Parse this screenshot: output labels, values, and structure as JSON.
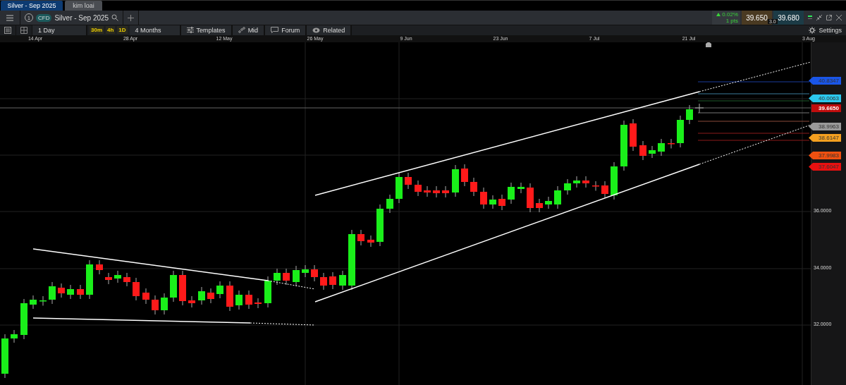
{
  "window_tabs": [
    {
      "label": "Silver - Sep 2025",
      "selected": true
    },
    {
      "label": "kim loai",
      "selected": false
    }
  ],
  "instrument": {
    "number": "1",
    "type": "CFD",
    "name": "Silver - Sep 2025"
  },
  "quote": {
    "change": "0.02%",
    "points": "1 pts",
    "sell": "39.650",
    "spread": "3.0",
    "buy": "39.680"
  },
  "toolbar": {
    "interval": "1 Day",
    "quick_intervals": [
      {
        "label": "30m"
      },
      {
        "label": "4h"
      },
      {
        "label": "1D"
      }
    ],
    "range": "4 Months",
    "buttons": [
      {
        "kind": "templates",
        "label": "Templates"
      },
      {
        "kind": "mid",
        "label": "Mid"
      },
      {
        "kind": "forum",
        "label": "Forum"
      },
      {
        "kind": "related",
        "label": "Related"
      }
    ],
    "settings": "Settings"
  },
  "chart": {
    "dates": [
      "14 Apr",
      "28 Apr",
      "12 May",
      "26 May",
      "9 Jun",
      "23 Jun",
      "7 Jul",
      "21 Jul",
      "3 Aug"
    ],
    "price_labels": [
      "36.0000",
      "34.0000",
      "32.0000"
    ],
    "price_tags": [
      {
        "label": "40.8347",
        "color": "#1a56e8",
        "kind": "level"
      },
      {
        "label": "40.0063",
        "color": "#2cc8ee",
        "kind": "level"
      },
      {
        "label": "39.6650",
        "color": "#c00d0d",
        "kind": "current"
      },
      {
        "label": "38.9963",
        "color": "#9a9a9a",
        "kind": "level"
      },
      {
        "label": "38.6147",
        "color": "#f5a020",
        "kind": "level"
      },
      {
        "label": "37.9983",
        "color": "#f05010",
        "kind": "level"
      },
      {
        "label": "37.6047",
        "color": "#e81010",
        "kind": "level"
      }
    ]
  }
}
